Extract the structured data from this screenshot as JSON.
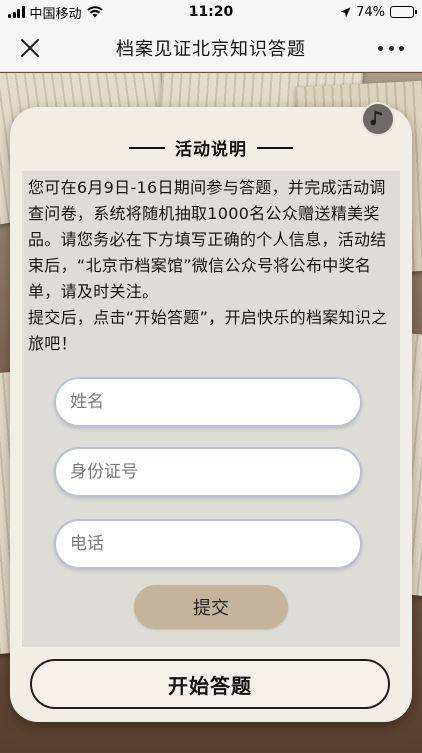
{
  "status_bar": {
    "carrier": "中国移动",
    "time": "11:20",
    "battery": "74%",
    "battery_level": 0.74
  },
  "nav": {
    "title": "档案见证北京知识答题"
  },
  "intro": {
    "heading": "活动说明",
    "paragraph1": "您可在6月9日-16日期间参与答题，并完成活动调查问卷，系统将随机抽取1000名公众赠送精美奖品。请您务必在下方填写正确的个人信息，活动结束后，“北京市档案馆”微信公众号将公布中奖名单，请及时关注。",
    "paragraph2": "提交后，点击“开始答题”，开启快乐的档案知识之旅吧！"
  },
  "form": {
    "name_placeholder": "姓名",
    "id_placeholder": "身份证号",
    "phone_placeholder": "电话",
    "submit_label": "提交"
  },
  "start_label": "开始答题",
  "colors": {
    "card_bg": "#f1eee6",
    "panel_bg": "#dedcd6",
    "submit_bg": "#c4b49b",
    "input_border": "#b7c2d8"
  },
  "icons": [
    "signal-icon",
    "wifi-icon",
    "location-arrow-icon",
    "battery-icon",
    "close-icon",
    "more-icon",
    "music-note-icon"
  ]
}
